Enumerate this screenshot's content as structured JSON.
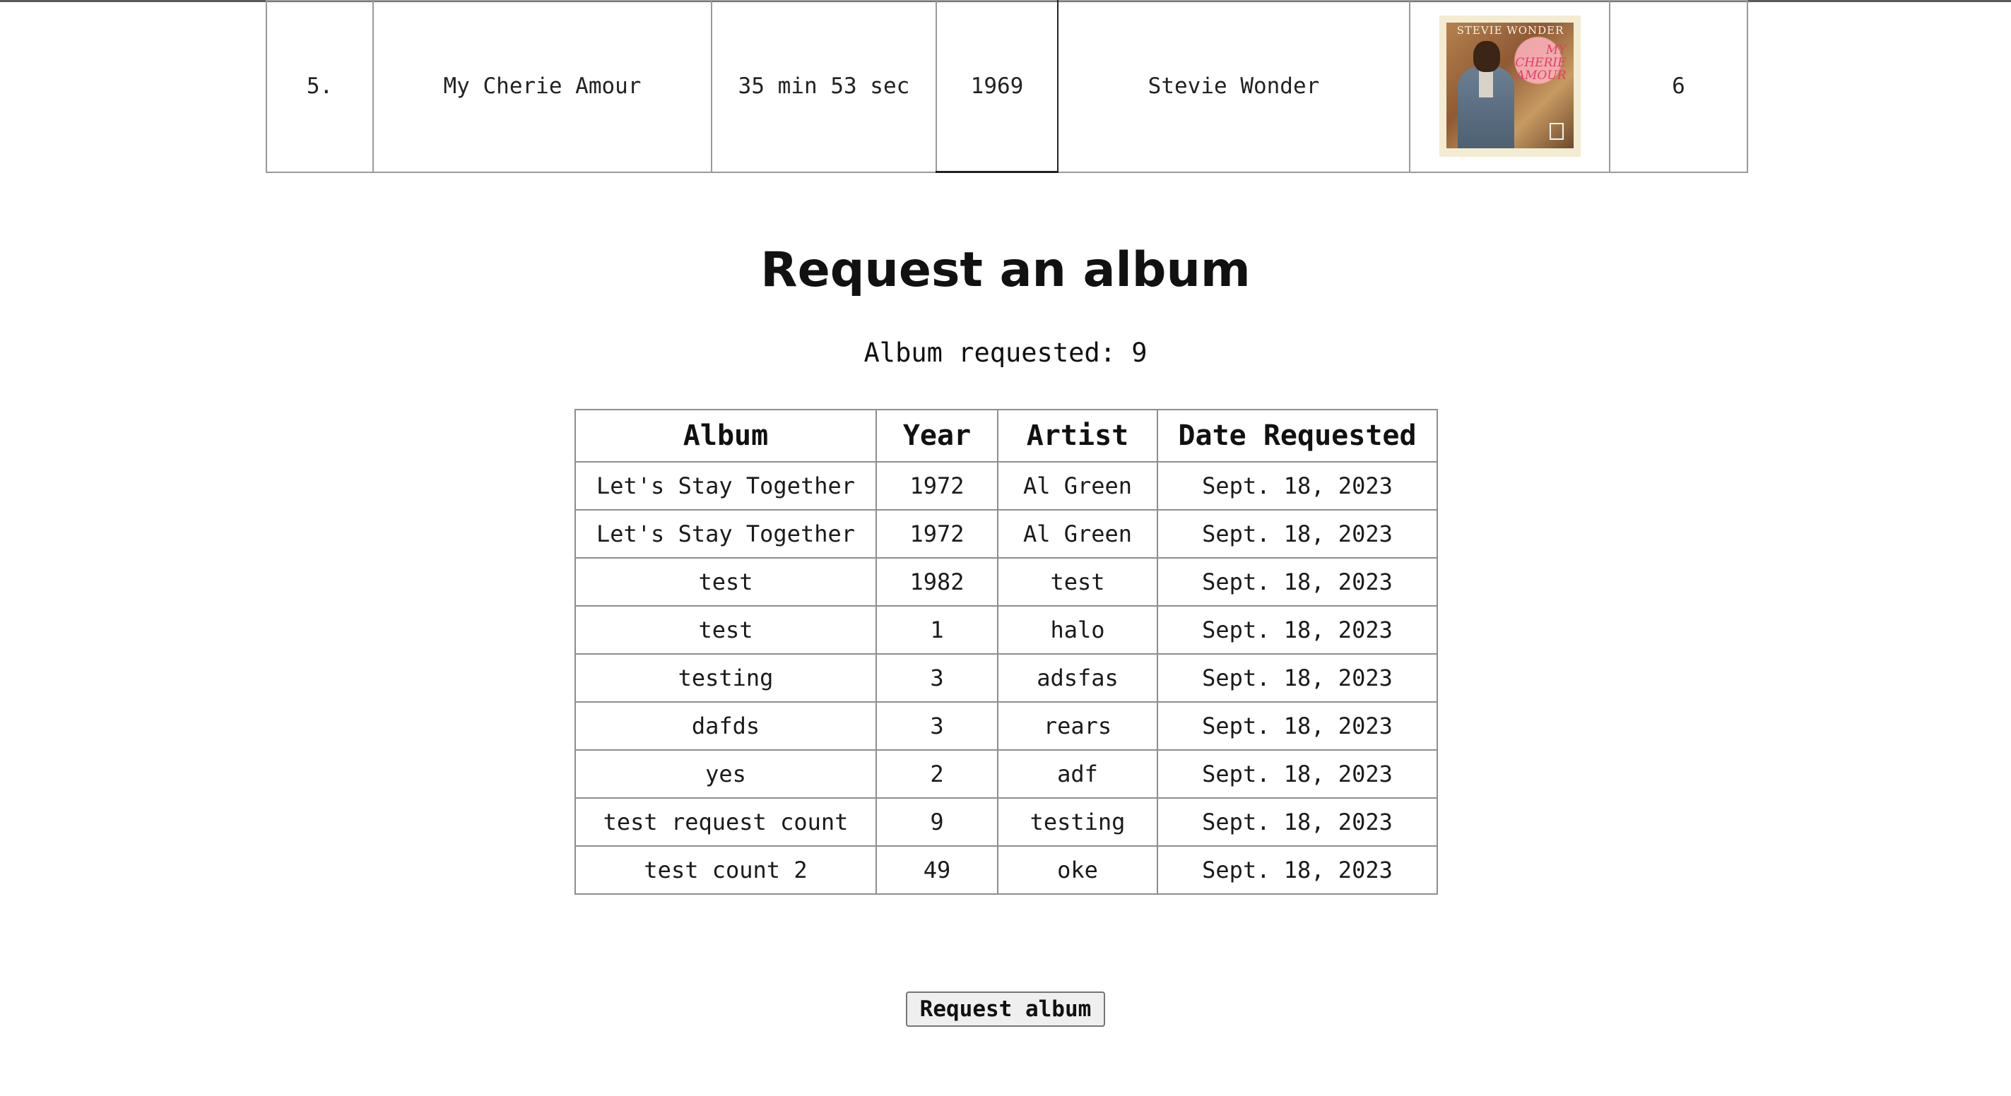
{
  "album_row": {
    "rank": "5.",
    "title": "My Cherie Amour",
    "length": "35 min 53 sec",
    "year": "1969",
    "artist": "Stevie Wonder",
    "cover": {
      "title_text": "STEVIE WONDER",
      "subtitle_text": "MY CHERIE AMOUR",
      "colors": [
        "#f3ecd2",
        "#b5824e",
        "#e23d6b"
      ]
    },
    "count": "6"
  },
  "heading": "Request an album",
  "requested_line": "Album requested: 9",
  "requests_table": {
    "headers": [
      "Album",
      "Year",
      "Artist",
      "Date Requested"
    ],
    "rows": [
      [
        "Let's Stay Together",
        "1972",
        "Al Green",
        "Sept. 18, 2023"
      ],
      [
        "Let's Stay Together",
        "1972",
        "Al Green",
        "Sept. 18, 2023"
      ],
      [
        "test",
        "1982",
        "test",
        "Sept. 18, 2023"
      ],
      [
        "test",
        "1",
        "halo",
        "Sept. 18, 2023"
      ],
      [
        "testing",
        "3",
        "adsfas",
        "Sept. 18, 2023"
      ],
      [
        "dafds",
        "3",
        "rears",
        "Sept. 18, 2023"
      ],
      [
        "yes",
        "2",
        "adf",
        "Sept. 18, 2023"
      ],
      [
        "test request count",
        "9",
        "testing",
        "Sept. 18, 2023"
      ],
      [
        "test count 2",
        "49",
        "oke",
        "Sept. 18, 2023"
      ]
    ]
  },
  "request_button_label": "Request album"
}
